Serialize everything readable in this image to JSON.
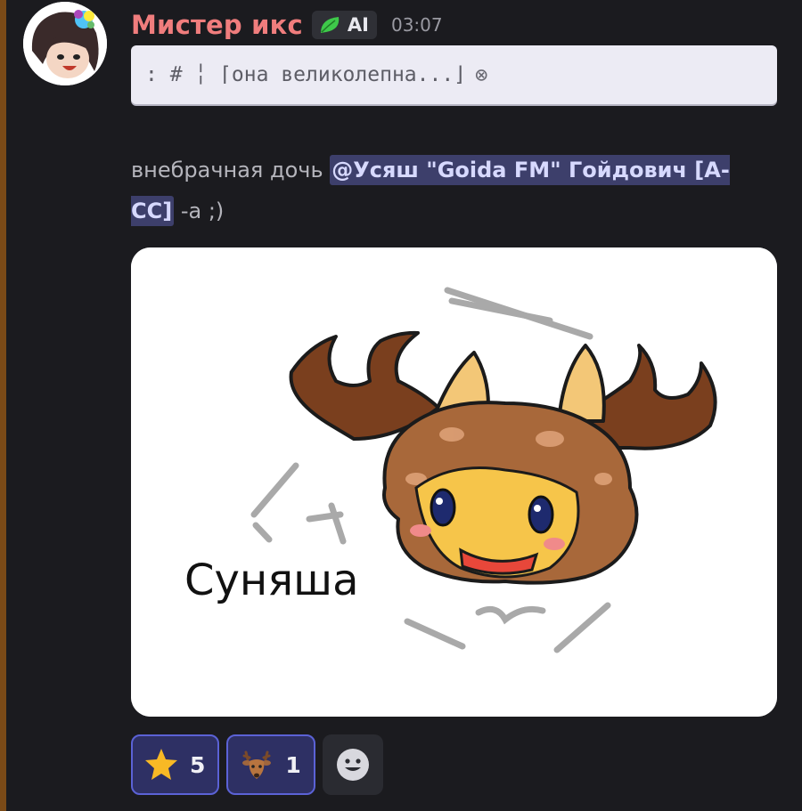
{
  "message": {
    "author": "Мистер икс",
    "tag": "AI",
    "timestamp": "03:07",
    "reply_preview": ": # ╎ ⌈она великолепна...⌋",
    "content_prefix": "внебрачная дочь ",
    "mention": "@Усяш \"Goida FM\" Гойдович [A-CC]",
    "content_suffix": " -а ;)",
    "attachment_caption": "Суняша"
  },
  "reactions": [
    {
      "emoji": "star-icon",
      "count": "5"
    },
    {
      "emoji": "deer-icon",
      "count": "1"
    }
  ],
  "colors": {
    "username": "#f07d7d",
    "mention_bg": "#3d3f6b",
    "reaction_border": "#5b62d6",
    "background": "#1b1b1f"
  }
}
